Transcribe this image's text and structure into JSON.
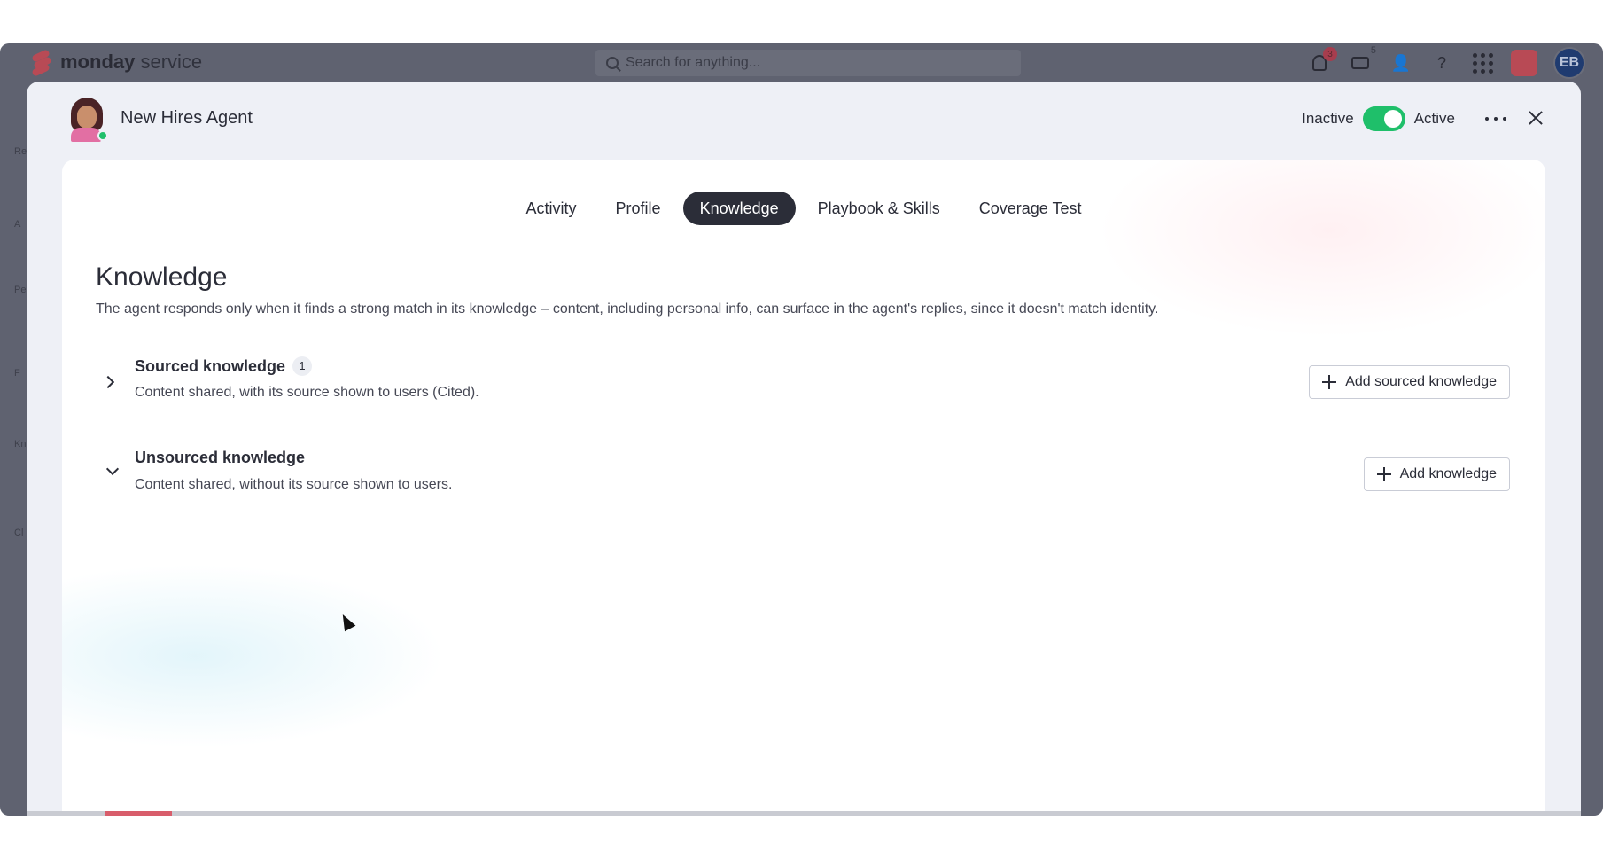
{
  "app": {
    "brand_bold": "monday",
    "brand_light": "service",
    "search_placeholder": "Search for anything...",
    "notifications_count": "3",
    "inbox_count": "5",
    "user_initials": "EB",
    "side_labels": [
      "Re",
      "A",
      "Per",
      "F",
      "Kn",
      "Cl"
    ]
  },
  "agent": {
    "name": "New Hires Agent",
    "inactive_label": "Inactive",
    "active_label": "Active",
    "is_active": true
  },
  "tabs": [
    {
      "label": "Activity",
      "active": false
    },
    {
      "label": "Profile",
      "active": false
    },
    {
      "label": "Knowledge",
      "active": true
    },
    {
      "label": "Playbook & Skills",
      "active": false
    },
    {
      "label": "Coverage Test",
      "active": false
    }
  ],
  "knowledge": {
    "title": "Knowledge",
    "description": "The agent responds only when it finds a strong match in its knowledge – content, including personal info, can surface in the agent's replies, since it doesn't match identity.",
    "sourced": {
      "title": "Sourced knowledge",
      "count": "1",
      "description": "Content shared, with its source shown to users (Cited).",
      "button": "Add sourced knowledge",
      "expanded": false
    },
    "unsourced": {
      "title": "Unsourced knowledge",
      "description": "Content shared, without its source shown to users.",
      "button": "Add knowledge",
      "expanded": true
    }
  },
  "colors": {
    "accent_dark": "#2b2d38",
    "toggle_on": "#1fbf6a",
    "brand": "#b84a55"
  }
}
